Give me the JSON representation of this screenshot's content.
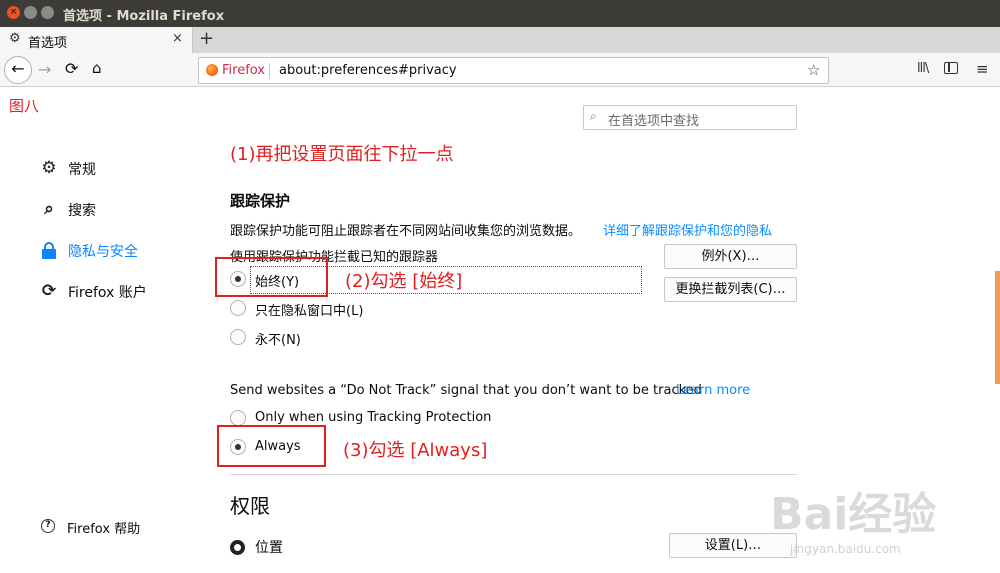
{
  "window": {
    "title": "首选项 - Mozilla Firefox"
  },
  "tab": {
    "label": "首选项",
    "icon": "gear-icon",
    "close": "×"
  },
  "newtab": "+",
  "toolbar": {
    "back": "←",
    "forward": "→",
    "reload": "⟳",
    "home": "⌂",
    "url_brand": "Firefox",
    "url": "about:preferences#privacy",
    "star": "☆",
    "library": "lll\\",
    "menu": "≡"
  },
  "annotations": {
    "figure": "图八",
    "step1": "(1)再把设置页面往下拉一点",
    "step2": "(2)勾选 [始终]",
    "step3": "(3)勾选 [Always]",
    "color": "#e02020"
  },
  "search": {
    "placeholder": "在首选项中查找",
    "icon": "search-icon"
  },
  "sidebar": {
    "items": [
      {
        "label": "常规",
        "icon": "gear-icon"
      },
      {
        "label": "搜索",
        "icon": "search-icon"
      },
      {
        "label": "隐私与安全",
        "icon": "lock-icon",
        "active": true
      },
      {
        "label": "Firefox 账户",
        "icon": "sync-icon"
      }
    ],
    "help": "Firefox 帮助"
  },
  "tracking": {
    "heading": "跟踪保护",
    "description": "跟踪保护功能可阻止跟踪者在不同网站间收集您的浏览数据。",
    "learn_link": "详细了解跟踪保护和您的隐私",
    "subheading": "使用跟踪保护功能拦截已知的跟踪器",
    "options": [
      {
        "label": "始终(Y)",
        "checked": true
      },
      {
        "label": "只在隐私窗口中(L)",
        "checked": false
      },
      {
        "label": "永不(N)",
        "checked": false
      }
    ],
    "exceptions_button": "例外(X)…",
    "change_list_button": "更换拦截列表(C)…"
  },
  "dnt": {
    "label": "Send websites a “Do Not Track” signal that you don’t want to be tracked",
    "learn_more": "Learn more",
    "options": [
      {
        "label": "Only when using Tracking Protection",
        "checked": false
      },
      {
        "label": "Always",
        "checked": true
      }
    ]
  },
  "permissions": {
    "heading": "权限",
    "location_label": "位置",
    "location_button": "设置(L)…"
  },
  "watermark": {
    "big": "Bai经验",
    "small": "jingyan.baidu.com"
  },
  "colors": {
    "accent": "#0a84ff",
    "link": "#0a8dff",
    "titlebar": "#3c3b37"
  }
}
